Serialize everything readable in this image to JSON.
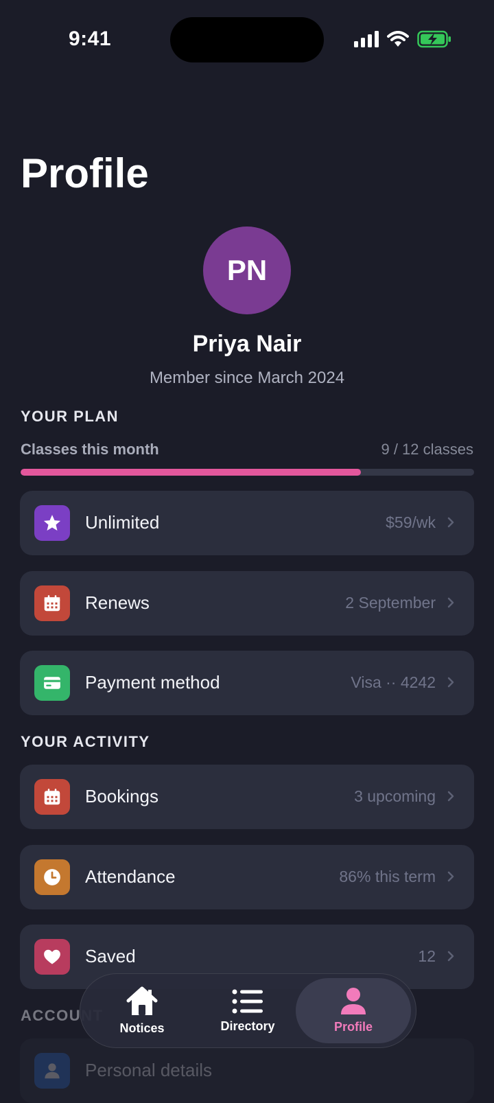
{
  "status_bar": {
    "time": "9:41"
  },
  "header": {
    "title": "Profile"
  },
  "profile": {
    "initials": "PN",
    "name": "Priya Nair",
    "member_since": "Member since March 2024",
    "avatar_color": "#7a3b92"
  },
  "plan": {
    "section_title": "YOUR PLAN",
    "usage_label": "Classes this month",
    "usage_value": "9 / 12 classes",
    "usage_fraction": 0.75,
    "accent_color": "#e3579c",
    "rows": [
      {
        "label": "Unlimited",
        "value": "$59/wk",
        "icon": "star-icon",
        "color": "#7b3fc4"
      },
      {
        "label": "Renews",
        "value": "2 September",
        "icon": "calendar-icon",
        "color": "#c2483a"
      },
      {
        "label": "Payment method",
        "value": "Visa ·· 4242",
        "icon": "credit-card-icon",
        "color": "#34b56a"
      }
    ]
  },
  "activity": {
    "section_title": "YOUR ACTIVITY",
    "rows": [
      {
        "label": "Bookings",
        "value": "3 upcoming",
        "icon": "calendar-icon",
        "color": "#c2483a"
      },
      {
        "label": "Attendance",
        "value": "86% this term",
        "icon": "clock-icon",
        "color": "#c4782f"
      },
      {
        "label": "Saved",
        "value": "12",
        "icon": "heart-icon",
        "color": "#b83c5e"
      }
    ]
  },
  "account": {
    "section_title": "ACCOUNT",
    "rows": [
      {
        "label": "Personal details",
        "icon": "person-icon",
        "color": "#2d6fd1"
      }
    ]
  },
  "tab_bar": {
    "items": [
      {
        "label": "Notices",
        "icon": "house-icon"
      },
      {
        "label": "Directory",
        "icon": "list-icon"
      },
      {
        "label": "Profile",
        "icon": "person-icon",
        "active": true
      }
    ]
  }
}
